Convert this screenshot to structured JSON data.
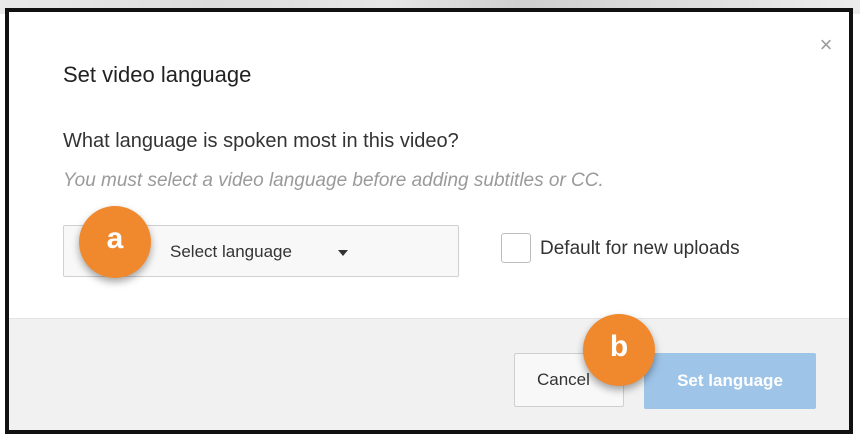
{
  "dialog": {
    "title": "Set video language",
    "question": "What language is spoken most in this video?",
    "hint": "You must select a video language before adding subtitles or CC.",
    "close_icon": "×"
  },
  "language_select": {
    "label": "Select language",
    "icon": "caret-down-icon"
  },
  "default_checkbox": {
    "label": "Default for new uploads",
    "checked": false
  },
  "footer": {
    "cancel_label": "Cancel",
    "set_language_label": "Set language"
  },
  "callouts": {
    "a": "a",
    "b": "b"
  },
  "colors": {
    "primary_button": "#9ec4e8",
    "callout": "#f0892e",
    "footer_bg": "#f1f1f1"
  }
}
